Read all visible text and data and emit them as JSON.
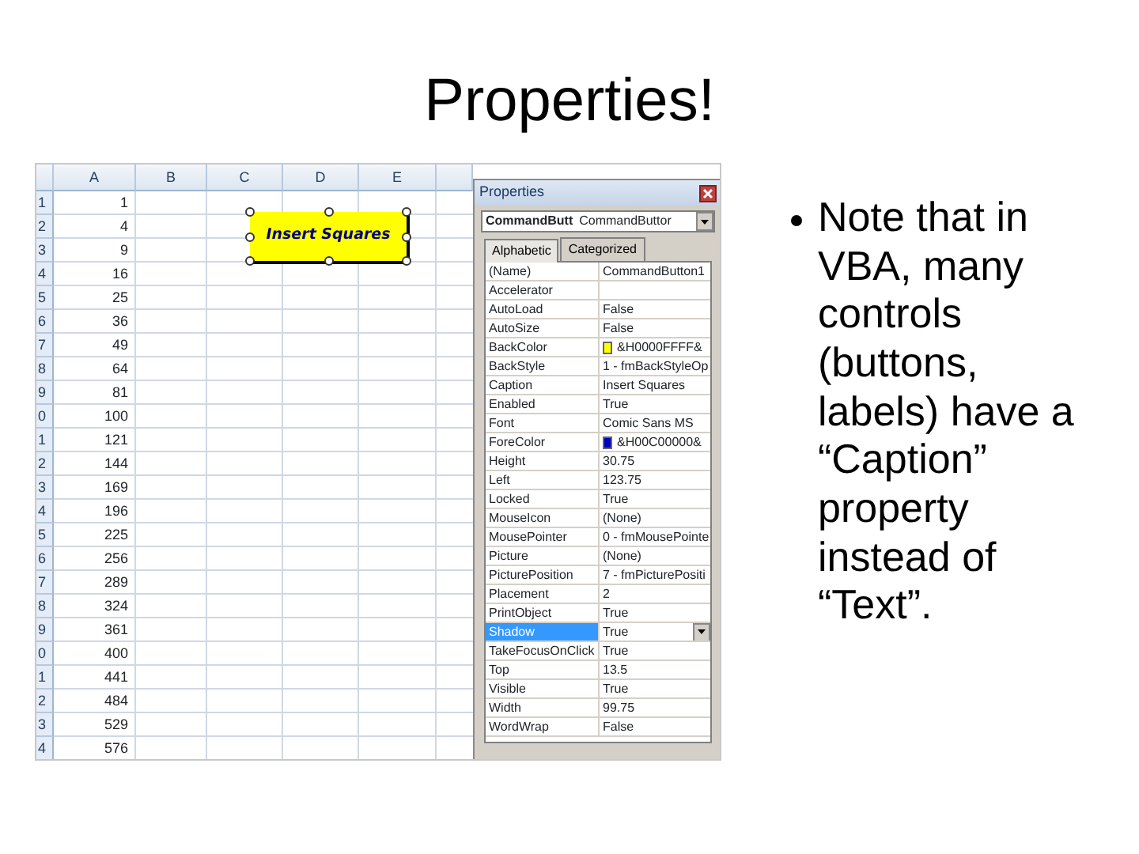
{
  "slide": {
    "title": "Properties!",
    "bullet": "Note that in VBA, many controls (buttons, labels) have a “Caption” property instead of “Text”."
  },
  "sheet": {
    "columns": [
      "A",
      "B",
      "C",
      "D",
      "E"
    ],
    "rows": [
      {
        "header": "1",
        "a": "1"
      },
      {
        "header": "2",
        "a": "4"
      },
      {
        "header": "3",
        "a": "9"
      },
      {
        "header": "4",
        "a": "16"
      },
      {
        "header": "5",
        "a": "25"
      },
      {
        "header": "6",
        "a": "36"
      },
      {
        "header": "7",
        "a": "49"
      },
      {
        "header": "8",
        "a": "64"
      },
      {
        "header": "9",
        "a": "81"
      },
      {
        "header": "0",
        "a": "100"
      },
      {
        "header": "1",
        "a": "121"
      },
      {
        "header": "2",
        "a": "144"
      },
      {
        "header": "3",
        "a": "169"
      },
      {
        "header": "4",
        "a": "196"
      },
      {
        "header": "5",
        "a": "225"
      },
      {
        "header": "6",
        "a": "256"
      },
      {
        "header": "7",
        "a": "289"
      },
      {
        "header": "8",
        "a": "324"
      },
      {
        "header": "9",
        "a": "361"
      },
      {
        "header": "0",
        "a": "400"
      },
      {
        "header": "1",
        "a": "441"
      },
      {
        "header": "2",
        "a": "484"
      },
      {
        "header": "3",
        "a": "529"
      },
      {
        "header": "4",
        "a": "576"
      }
    ],
    "button": {
      "caption": "Insert Squares",
      "selected": true
    }
  },
  "properties": {
    "title": "Properties",
    "object": {
      "name": "CommandButt",
      "type": "CommandButtor"
    },
    "tabs": [
      {
        "label": "Alphabetic",
        "selected": true
      },
      {
        "label": "Categorized",
        "selected": false
      }
    ],
    "items": [
      {
        "name": "(Name)",
        "value": "CommandButton1",
        "selected": false
      },
      {
        "name": "Accelerator",
        "value": "",
        "selected": false
      },
      {
        "name": "AutoLoad",
        "value": "False",
        "selected": false
      },
      {
        "name": "AutoSize",
        "value": "False",
        "selected": false
      },
      {
        "name": "BackColor",
        "value": "&H0000FFFF&",
        "color": "#ffff00",
        "selected": false
      },
      {
        "name": "BackStyle",
        "value": "1 - fmBackStyleOp",
        "selected": false
      },
      {
        "name": "Caption",
        "value": "Insert Squares",
        "selected": false
      },
      {
        "name": "Enabled",
        "value": "True",
        "selected": false
      },
      {
        "name": "Font",
        "value": "Comic Sans MS",
        "selected": false
      },
      {
        "name": "ForeColor",
        "value": "&H00C00000&",
        "color": "#0000c0",
        "selected": false
      },
      {
        "name": "Height",
        "value": "30.75",
        "selected": false
      },
      {
        "name": "Left",
        "value": "123.75",
        "selected": false
      },
      {
        "name": "Locked",
        "value": "True",
        "selected": false
      },
      {
        "name": "MouseIcon",
        "value": "(None)",
        "selected": false
      },
      {
        "name": "MousePointer",
        "value": "0 - fmMousePointe",
        "selected": false
      },
      {
        "name": "Picture",
        "value": "(None)",
        "selected": false
      },
      {
        "name": "PicturePosition",
        "value": "7 - fmPicturePositi",
        "selected": false
      },
      {
        "name": "Placement",
        "value": "2",
        "selected": false
      },
      {
        "name": "PrintObject",
        "value": "True",
        "selected": false
      },
      {
        "name": "Shadow",
        "value": "True",
        "selected": true
      },
      {
        "name": "TakeFocusOnClick",
        "value": "True",
        "selected": false
      },
      {
        "name": "Top",
        "value": "13.5",
        "selected": false
      },
      {
        "name": "Visible",
        "value": "True",
        "selected": false
      },
      {
        "name": "Width",
        "value": "99.75",
        "selected": false
      },
      {
        "name": "WordWrap",
        "value": "False",
        "selected": false
      }
    ]
  }
}
